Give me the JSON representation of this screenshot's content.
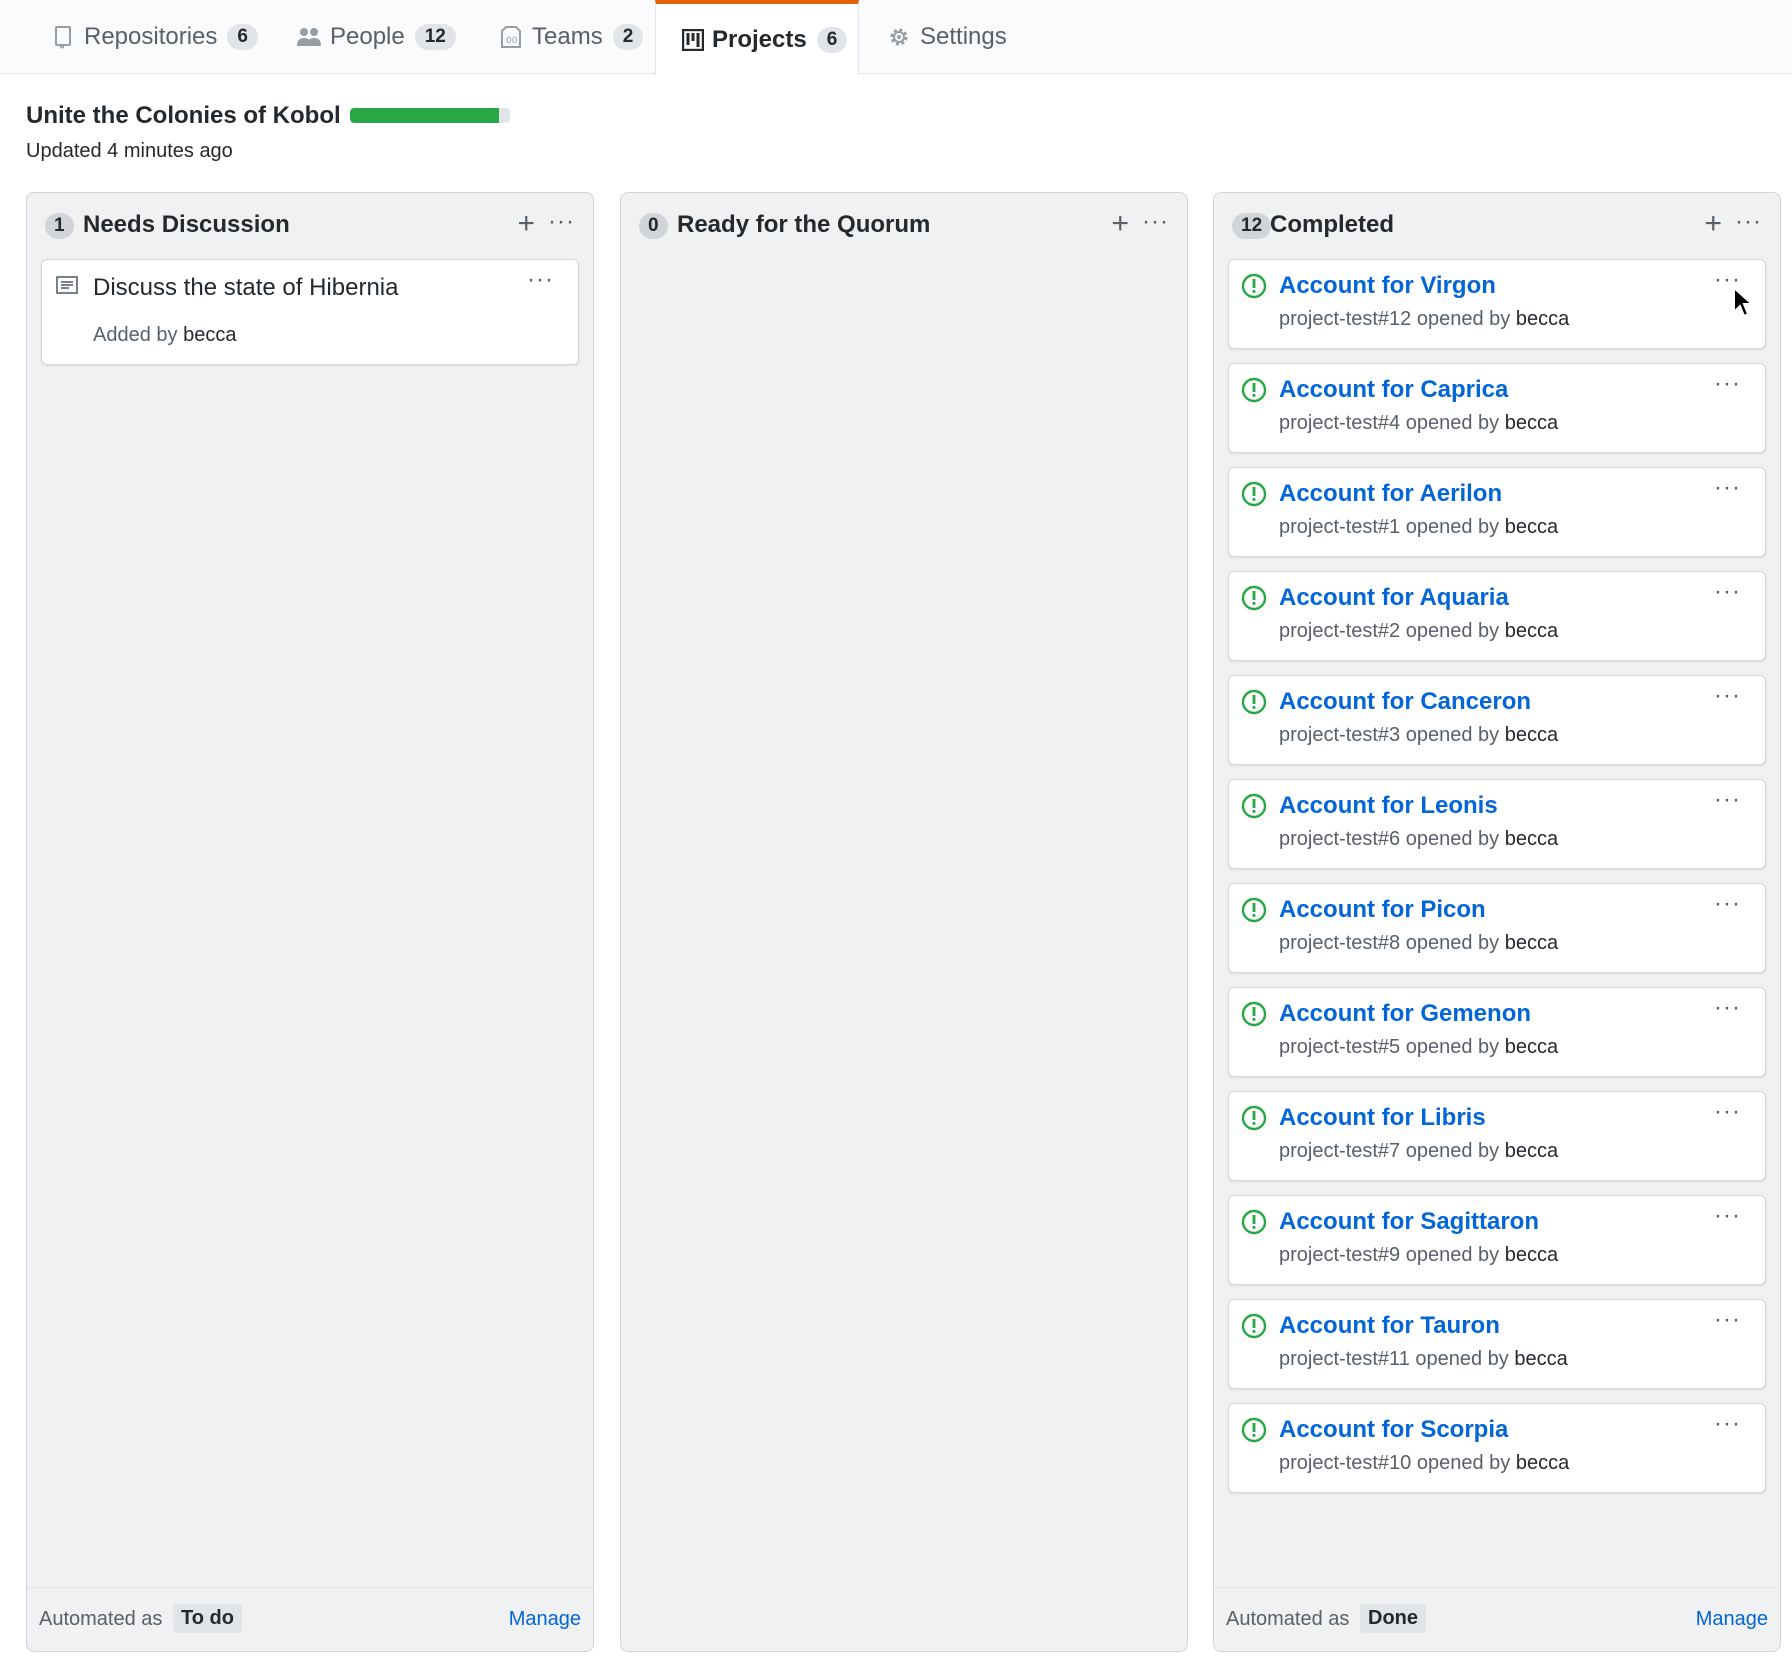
{
  "tabs": [
    {
      "label": "Repositories",
      "count": "6",
      "icon": "repo-icon"
    },
    {
      "label": "People",
      "count": "12",
      "icon": "people-icon"
    },
    {
      "label": "Teams",
      "count": "2",
      "icon": "jersey-icon"
    },
    {
      "label": "Projects",
      "count": "6",
      "icon": "project-icon",
      "selected": true
    },
    {
      "label": "Settings",
      "count": "",
      "icon": "gear-icon"
    }
  ],
  "project": {
    "title": "Unite the Colonies of Kobol",
    "updated": "Updated 4 minutes ago",
    "progress_fraction": 0.93
  },
  "columns": [
    {
      "name": "Needs Discussion",
      "count": "1",
      "footer": {
        "label": "Automated as",
        "tag": "To do",
        "manage": "Manage"
      },
      "notes": [
        {
          "text": "Discuss the state of Hibernia",
          "added_by_label": "Added by",
          "user": "becca"
        }
      ]
    },
    {
      "name": "Ready for the Quorum",
      "count": "0"
    },
    {
      "name": "Completed",
      "count": "12",
      "footer": {
        "label": "Automated as",
        "tag": "Done",
        "manage": "Manage"
      },
      "issues": [
        {
          "title": "Account for Virgon",
          "ref": "project-test#12",
          "opened": "opened by",
          "user": "becca"
        },
        {
          "title": "Account for Caprica",
          "ref": "project-test#4",
          "opened": "opened by",
          "user": "becca"
        },
        {
          "title": "Account for Aerilon",
          "ref": "project-test#1",
          "opened": "opened by",
          "user": "becca"
        },
        {
          "title": "Account for Aquaria",
          "ref": "project-test#2",
          "opened": "opened by",
          "user": "becca"
        },
        {
          "title": "Account for Canceron",
          "ref": "project-test#3",
          "opened": "opened by",
          "user": "becca"
        },
        {
          "title": "Account for Leonis",
          "ref": "project-test#6",
          "opened": "opened by",
          "user": "becca"
        },
        {
          "title": "Account for Picon",
          "ref": "project-test#8",
          "opened": "opened by",
          "user": "becca"
        },
        {
          "title": "Account for Gemenon",
          "ref": "project-test#5",
          "opened": "opened by",
          "user": "becca"
        },
        {
          "title": "Account for Libris",
          "ref": "project-test#7",
          "opened": "opened by",
          "user": "becca"
        },
        {
          "title": "Account for Sagittaron",
          "ref": "project-test#9",
          "opened": "opened by",
          "user": "becca"
        },
        {
          "title": "Account for Tauron",
          "ref": "project-test#11",
          "opened": "opened by",
          "user": "becca"
        },
        {
          "title": "Account for Scorpia",
          "ref": "project-test#10",
          "opened": "opened by",
          "user": "becca"
        }
      ]
    }
  ],
  "colors": {
    "accent_tab": "#e36209",
    "progress": "#28a745",
    "link": "#0366d6",
    "issue_open": "#28a745"
  }
}
